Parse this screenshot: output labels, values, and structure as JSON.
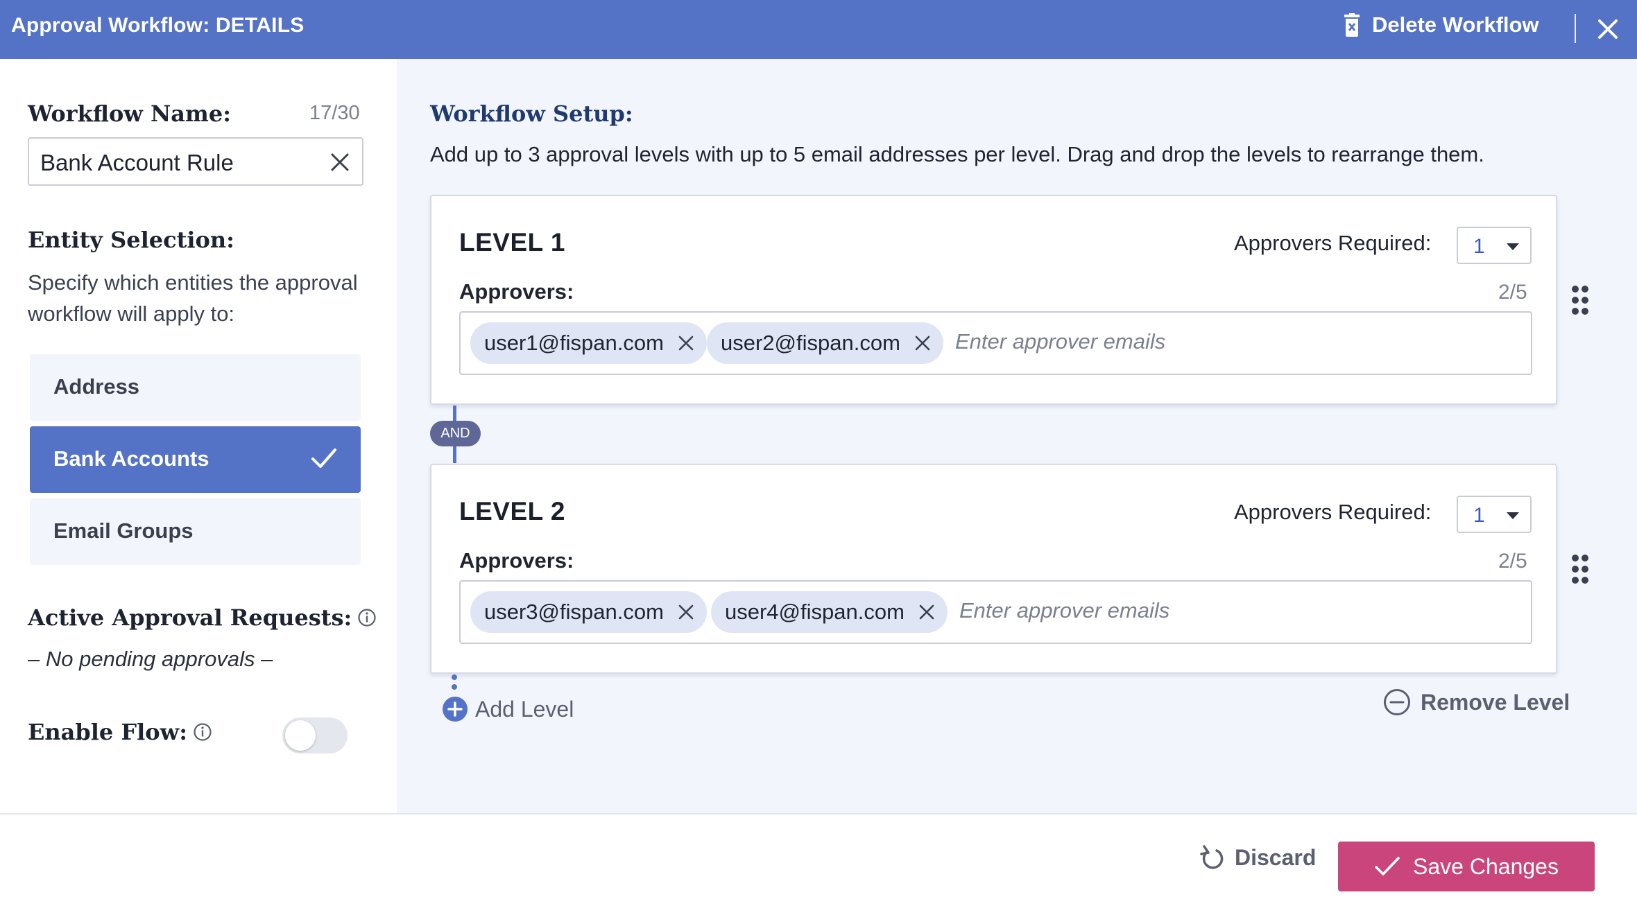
{
  "header": {
    "title": "Approval Workflow: DETAILS",
    "delete_label": "Delete Workflow",
    "delete_icon": "trash-icon",
    "close_icon": "close-icon",
    "background": "#5472c6"
  },
  "left": {
    "workflow_name_label": "Workflow Name:",
    "workflow_name_count": "17/30",
    "workflow_name_value": "Bank Account Rule",
    "entity_label": "Entity Selection:",
    "entity_desc": "Specify which entities the approval workflow will apply to:",
    "entities": [
      {
        "label": "Address",
        "selected": false
      },
      {
        "label": "Bank Accounts",
        "selected": true
      },
      {
        "label": "Email Groups",
        "selected": false
      }
    ],
    "active_requests_label": "Active Approval Requests:",
    "no_pending": "– No pending approvals –",
    "enable_flow_label": "Enable Flow:",
    "enable_flow_on": false
  },
  "right": {
    "setup_label": "Workflow Setup:",
    "setup_desc": "Add up to 3 approval levels with up to 5 email addresses per level. Drag and drop the levels to rearrange them.",
    "levels": [
      {
        "title": "LEVEL 1",
        "approvers_required_label": "Approvers Required:",
        "approvers_required": "1",
        "approvers_label": "Approvers:",
        "count": "2/5",
        "emails": [
          "user1@fispan.com",
          "user2@fispan.com"
        ],
        "placeholder": "Enter approver emails"
      },
      {
        "title": "LEVEL 2",
        "approvers_required_label": "Approvers Required:",
        "approvers_required": "1",
        "approvers_label": "Approvers:",
        "count": "2/5",
        "emails": [
          "user3@fispan.com",
          "user4@fispan.com"
        ],
        "placeholder": "Enter approver emails"
      }
    ],
    "connector_label": "AND",
    "add_level_label": "Add Level",
    "remove_level_label": "Remove Level"
  },
  "footer": {
    "discard_label": "Discard",
    "save_label": "Save Changes",
    "save_color": "#c9457c"
  }
}
